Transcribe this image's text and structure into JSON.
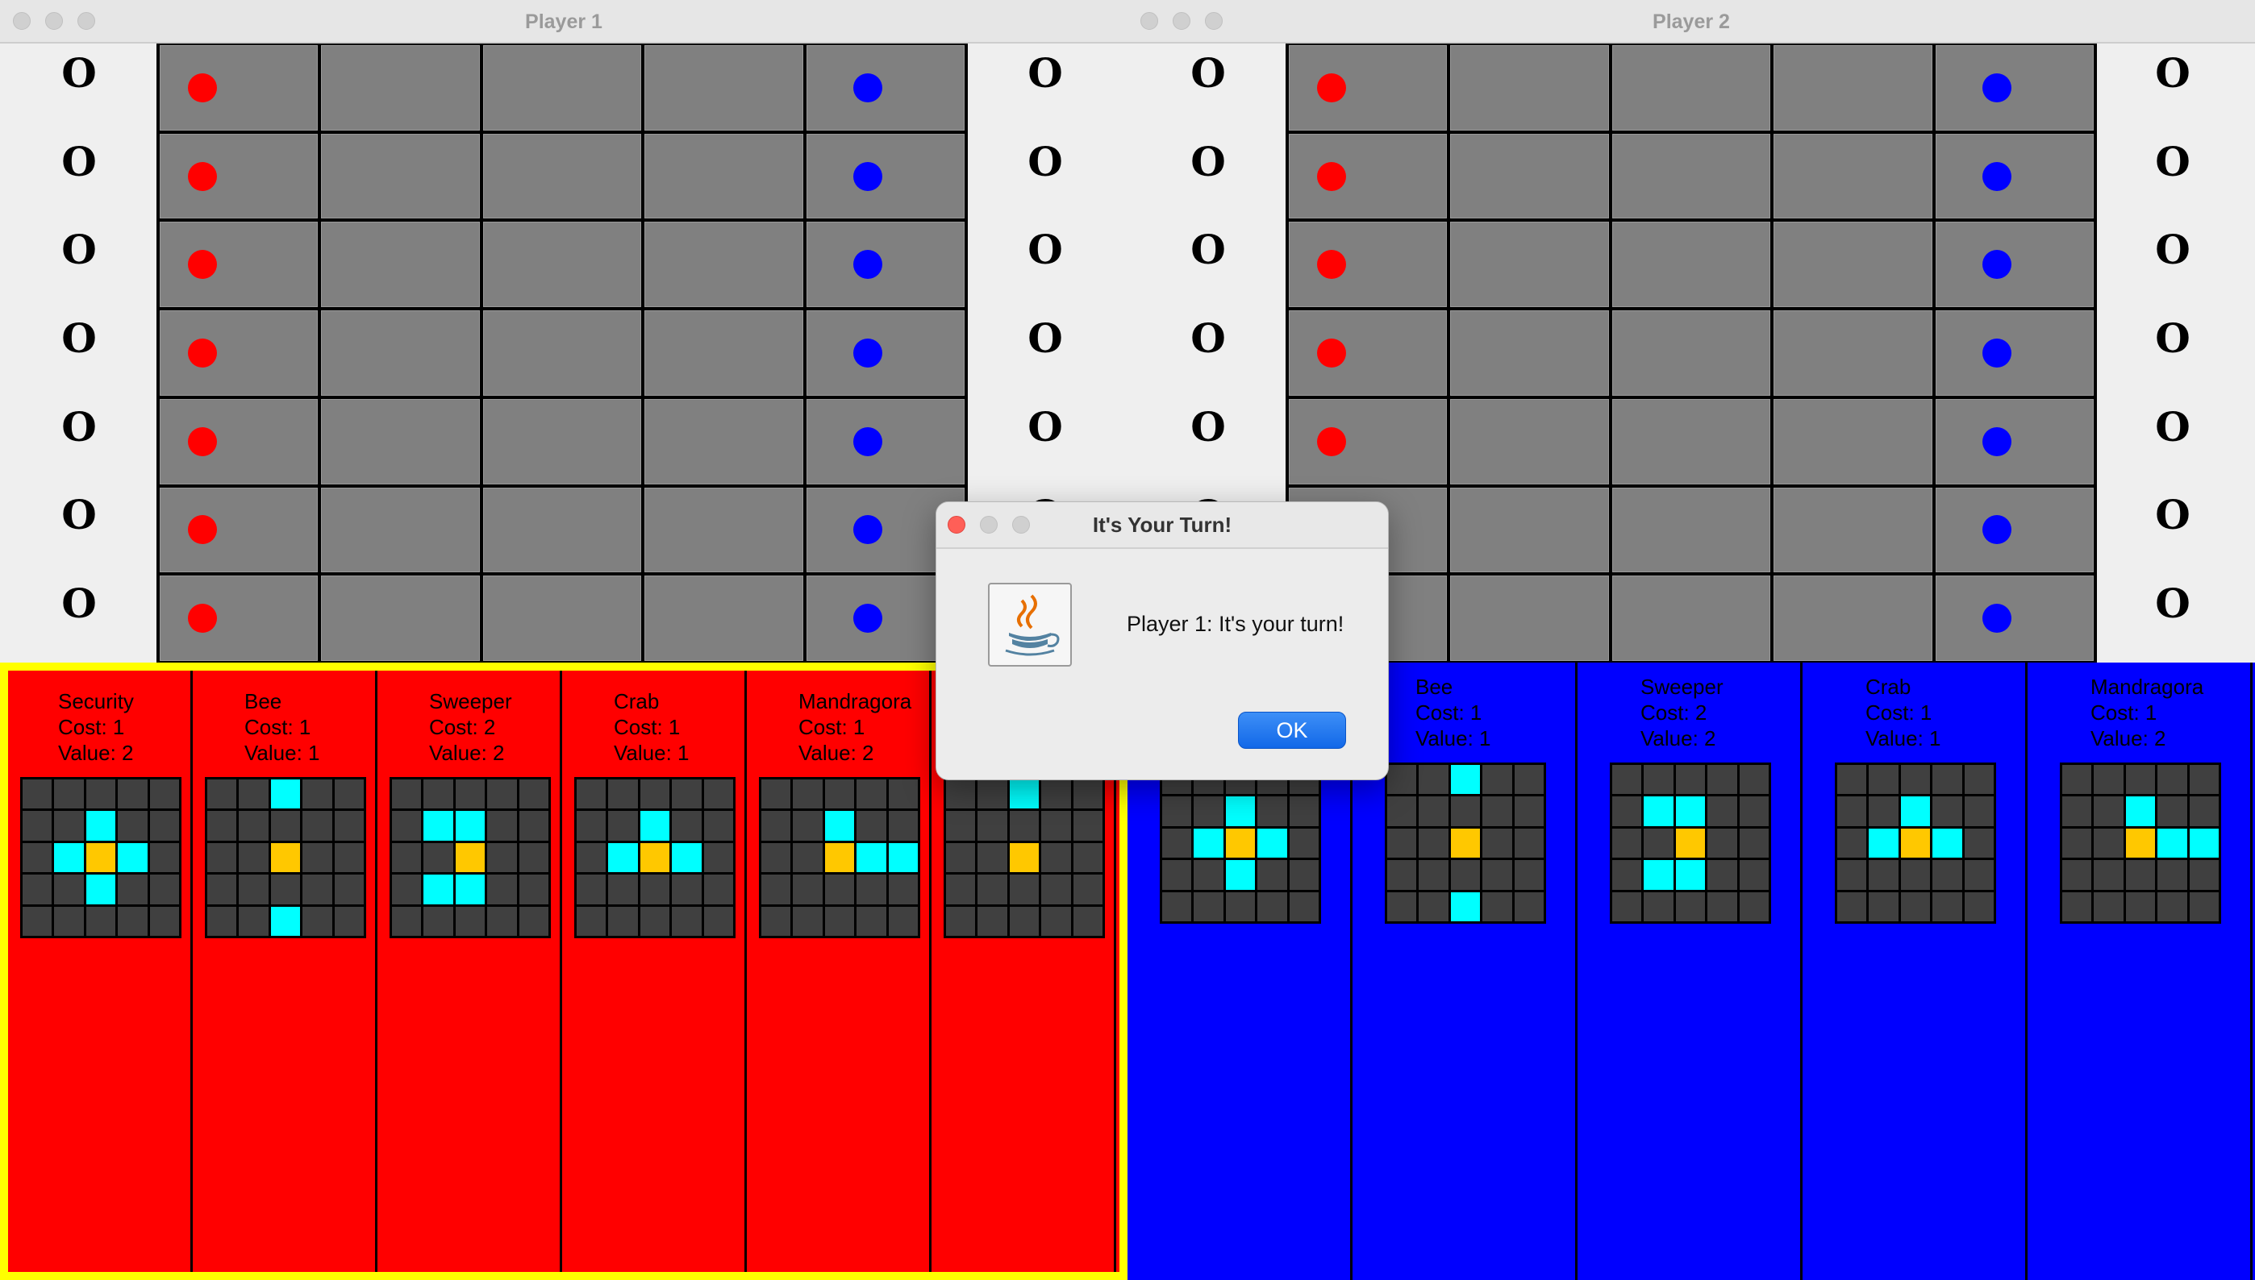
{
  "windows": [
    {
      "title": "Player 1",
      "hand_color": "#ff0000",
      "highlight": "#ffff00"
    },
    {
      "title": "Player 2",
      "hand_color": "#0000ff"
    }
  ],
  "score_marker": "O",
  "board": {
    "rows": 7,
    "cols": 5,
    "left_pawn_color": "#ff0000",
    "right_pawn_color": "#0000ff"
  },
  "hand1": [
    {
      "name": "Security",
      "cost": "Cost: 1",
      "value": "Value: 2",
      "pattern": ".....|..c..|.coc.|..c..|....."
    },
    {
      "name": "Bee",
      "cost": "Cost: 1",
      "value": "Value: 1",
      "pattern": "..c..|.....|..o..|.....|..c.."
    },
    {
      "name": "Sweeper",
      "cost": "Cost: 2",
      "value": "Value: 2",
      "pattern": ".....|.cc..|..o..|.cc..|....."
    },
    {
      "name": "Crab",
      "cost": "Cost: 1",
      "value": "Value: 1",
      "pattern": ".....|..c..|.coc.|.....|....."
    },
    {
      "name": "Mandragora",
      "cost": "Cost: 1",
      "value": "Value: 2",
      "pattern": ".....|..c..|..occ|.....|....."
    },
    {
      "name": "",
      "cost": "",
      "value": "",
      "pattern": "..c..|.....|..o..|.....|....."
    }
  ],
  "hand2": [
    {
      "name": "",
      "cost": "",
      "value": "",
      "pattern": ".....|..c..|.coc.|..c..|....."
    },
    {
      "name": "Bee",
      "cost": "Cost: 1",
      "value": "Value: 1",
      "pattern": "..c..|.....|..o..|.....|..c.."
    },
    {
      "name": "Sweeper",
      "cost": "Cost: 2",
      "value": "Value: 2",
      "pattern": ".....|.cc..|..o..|.cc..|....."
    },
    {
      "name": "Crab",
      "cost": "Cost: 1",
      "value": "Value: 1",
      "pattern": ".....|..c..|.coc.|.....|....."
    },
    {
      "name": "Mandragora",
      "cost": "Cost: 1",
      "value": "Value: 2",
      "pattern": ".....|..c..|..occ|.....|....."
    }
  ],
  "dialog": {
    "title": "It's Your Turn!",
    "message": "Player 1: It's your turn!",
    "ok_label": "OK"
  },
  "colors": {
    "cell_gray": "#808080",
    "pattern_dark": "#404040",
    "pattern_cyan": "#00ffff",
    "pattern_orange": "#ffc800"
  }
}
